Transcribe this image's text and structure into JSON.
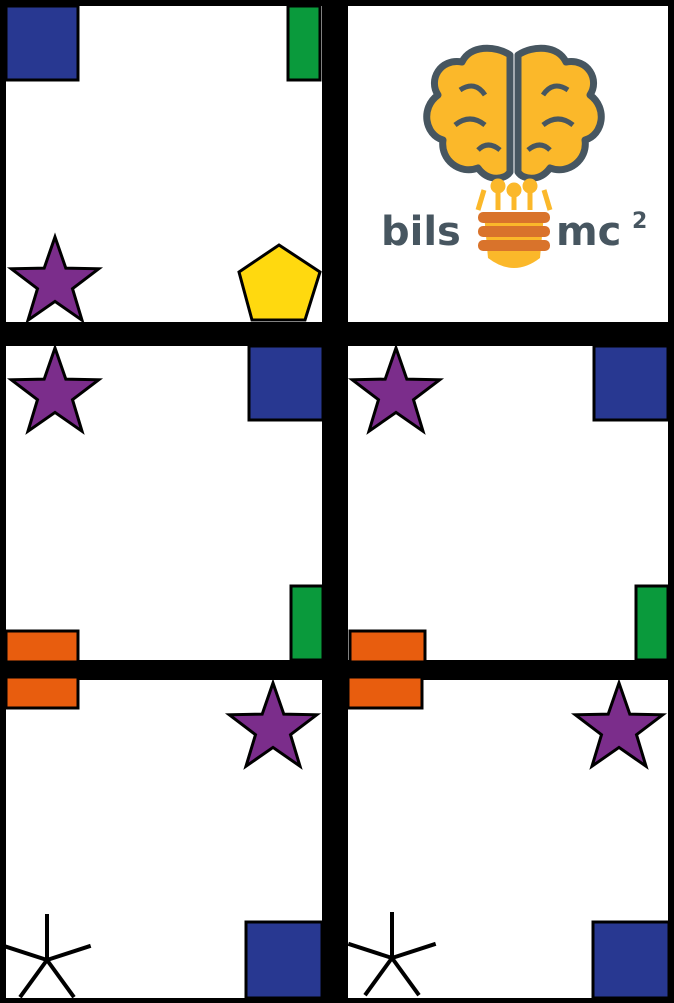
{
  "colors": {
    "background": "#000000",
    "panel": "#ffffff",
    "blue": "#283891",
    "green": "#0a9a3c",
    "orange": "#e85d0e",
    "purple": "#7b2d8b",
    "yellow": "#ffd90f",
    "logo_gray": "#475660",
    "logo_brain": "#fbb82a",
    "logo_coil": "#d9732b"
  },
  "logo": {
    "word_left": "bils",
    "word_right": "mc",
    "superscript": "2"
  },
  "panels": [
    {
      "name": "panel-top-left",
      "shapes": [
        "blue-square",
        "green-rectangle",
        "purple-star",
        "yellow-pentagon"
      ]
    },
    {
      "name": "panel-top-right",
      "shapes": [
        "bilsmc2-logo"
      ]
    },
    {
      "name": "panel-middle-left",
      "shapes": [
        "purple-star",
        "blue-square",
        "green-rectangle",
        "orange-rectangle"
      ]
    },
    {
      "name": "panel-middle-right",
      "shapes": [
        "purple-star",
        "blue-square",
        "green-rectangle",
        "orange-rectangle"
      ]
    },
    {
      "name": "panel-bottom-left",
      "shapes": [
        "orange-rectangle",
        "purple-star",
        "black-line-asterisk",
        "blue-square"
      ]
    },
    {
      "name": "panel-bottom-right",
      "shapes": [
        "orange-rectangle",
        "purple-star",
        "black-line-asterisk",
        "blue-square"
      ]
    }
  ]
}
